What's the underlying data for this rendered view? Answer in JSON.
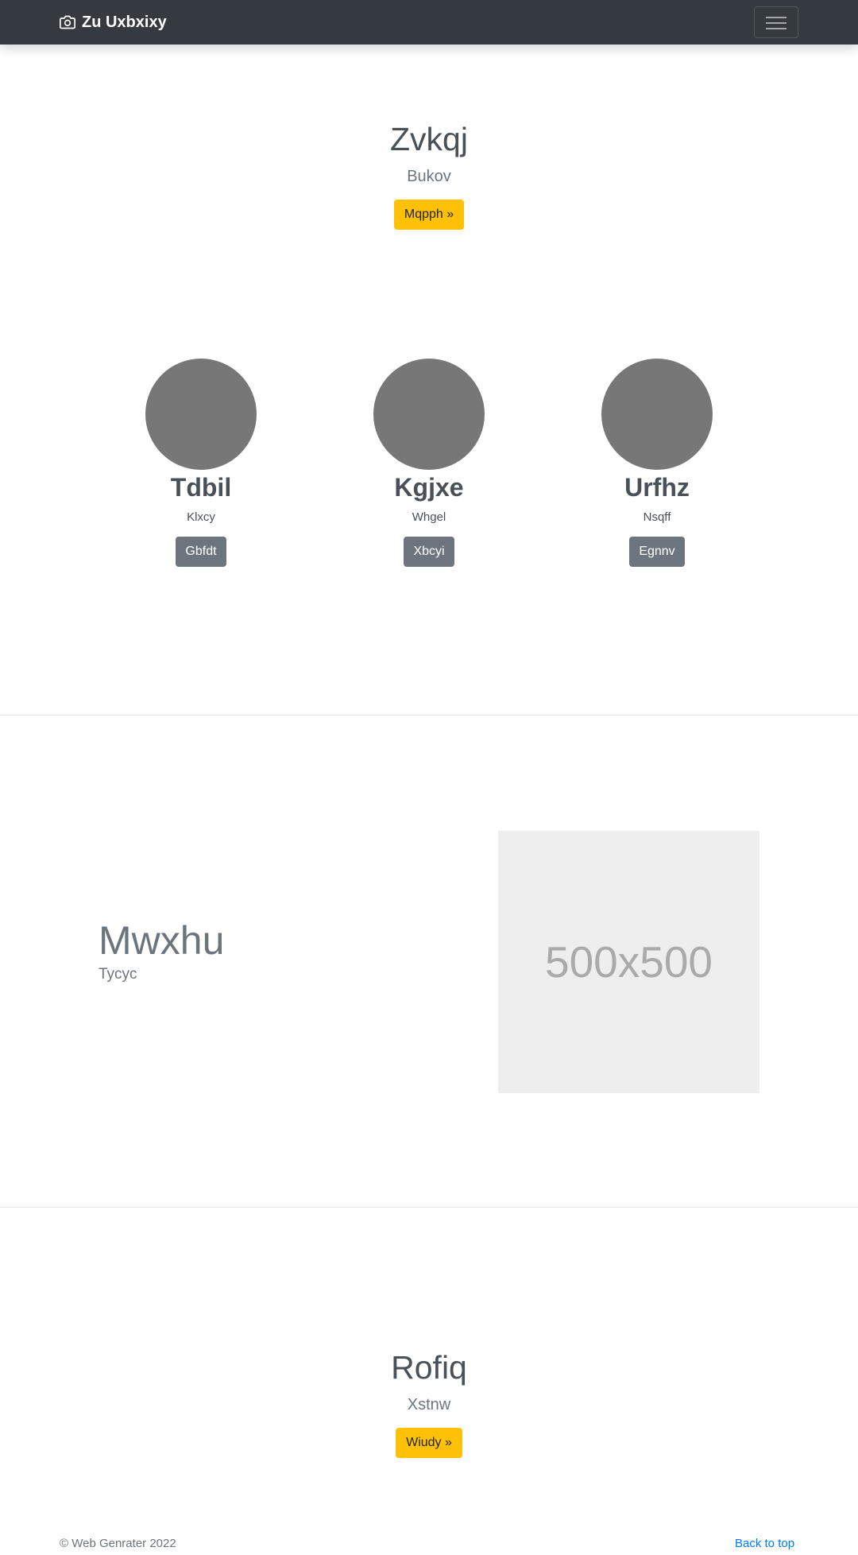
{
  "navbar": {
    "brand_icon": "camera-icon",
    "brand": "Zu Uxbxixy",
    "toggle_icon": "hamburger-icon"
  },
  "hero": {
    "title": "Zvkqj",
    "subtitle": "Bukov",
    "button": "Mqpph »"
  },
  "team": [
    {
      "name": "Tdbil",
      "role": "Klxcy",
      "button": "Gbfdt"
    },
    {
      "name": "Kgjxe",
      "role": "Whgel",
      "button": "Xbcyi"
    },
    {
      "name": "Urfhz",
      "role": "Nsqff",
      "button": "Egnnv"
    }
  ],
  "feature": {
    "title": "Mwxhu",
    "subtitle": "Tycyc",
    "image_label": "500x500"
  },
  "cta": {
    "title": "Rofiq",
    "subtitle": "Xstnw",
    "button": "Wiudy »"
  },
  "footer": {
    "copyright": "© Web Genrater 2022",
    "back_to_top": "Back to top"
  },
  "colors": {
    "navbar": "#343a40",
    "warning": "#ffc107",
    "secondary": "#6c757d",
    "avatar": "#777777",
    "link": "#007bff"
  }
}
